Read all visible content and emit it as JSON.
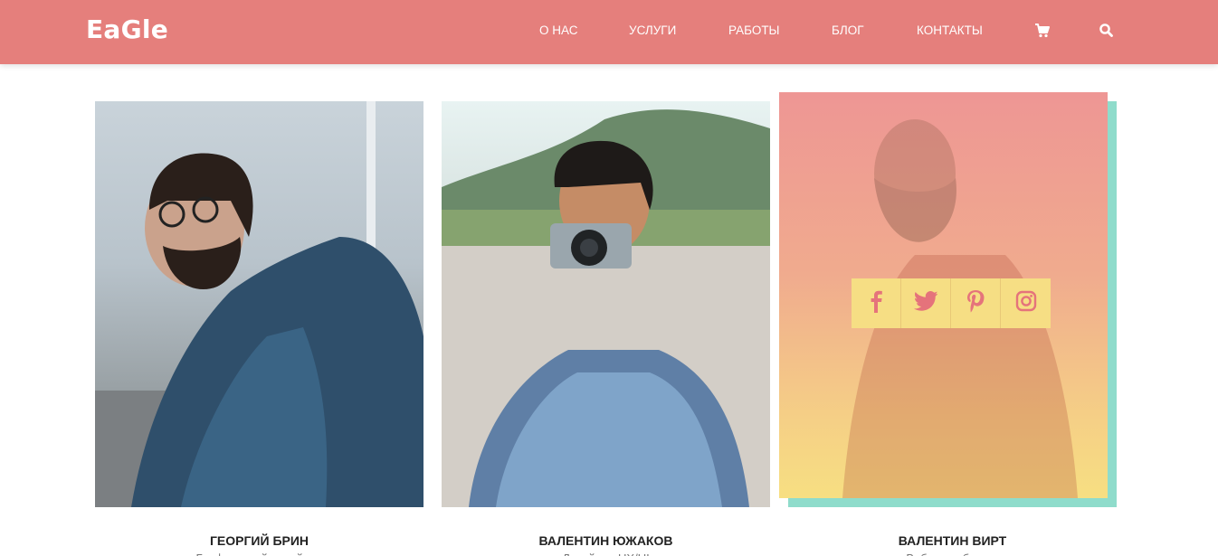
{
  "header": {
    "logo": "EaGle",
    "nav": [
      "О НАС",
      "УСЛУГИ",
      "РАБОТЫ",
      "БЛОГ",
      "КОНТАКТЫ"
    ],
    "icons": [
      "cart-icon",
      "search-icon"
    ]
  },
  "team": [
    {
      "name": "ГЕОРГИЙ БРИН",
      "role": "Графический дизайнер"
    },
    {
      "name": "ВАЛЕНТИН ЮЖАКОВ",
      "role": "Дизайнер UX/UI"
    },
    {
      "name": "ВАЛЕНТИН ВИРТ",
      "role": "Веб-разработчик"
    }
  ],
  "social": [
    "facebook-icon",
    "twitter-icon",
    "pinterest-icon",
    "instagram-icon"
  ],
  "colors": {
    "header": "#e57f7c",
    "overlay_top": "#ee9694",
    "overlay_bottom": "#f7df82",
    "teal": "#8fdccb",
    "social_icon": "#e5737b",
    "social_bg": "#f6de84"
  }
}
